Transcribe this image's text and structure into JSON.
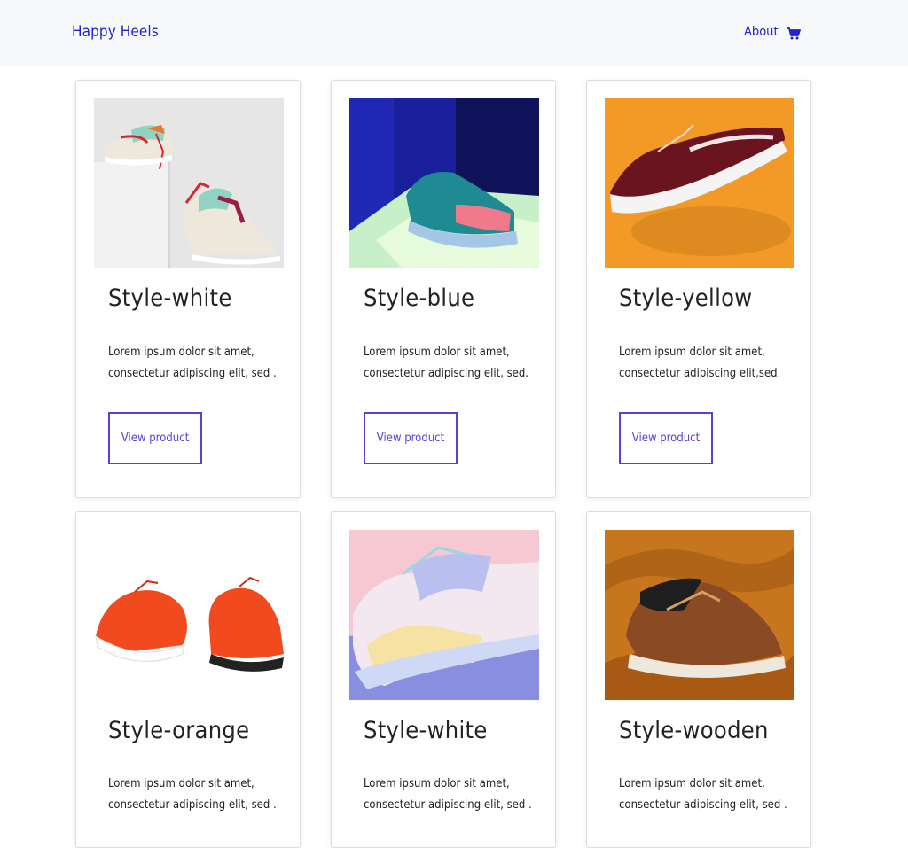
{
  "nav": {
    "brand": "Happy Heels",
    "about": "About",
    "cart_icon": "shopping-cart-icon"
  },
  "products": [
    {
      "title": "Style-white",
      "desc_line1": "Lorem ipsum dolor sit amet,",
      "desc_line2": "consectetur adipiscing elit, sed .",
      "button": "View product"
    },
    {
      "title": "Style-blue",
      "desc_line1": "Lorem ipsum dolor sit amet,",
      "desc_line2": "consectetur adipiscing elit, sed.",
      "button": "View product"
    },
    {
      "title": "Style-yellow",
      "desc_line1": "Lorem ipsum dolor sit amet,",
      "desc_line2": "consectetur adipiscing elit,sed.",
      "button": "View product"
    },
    {
      "title": "Style-orange",
      "desc_line1": "Lorem ipsum dolor sit amet,",
      "desc_line2": "consectetur adipiscing elit, sed ."
    },
    {
      "title": "Style-white",
      "desc_line1": "Lorem ipsum dolor sit amet,",
      "desc_line2": "consectetur adipiscing elit, sed ."
    },
    {
      "title": "Style-wooden",
      "desc_line1": "Lorem ipsum dolor sit amet,",
      "desc_line2": "consectetur adipiscing elit, sed ."
    }
  ],
  "colors": {
    "brand": "#2222cc",
    "button_border": "#5b3fd8",
    "navbar_bg": "#f7f8fa"
  }
}
